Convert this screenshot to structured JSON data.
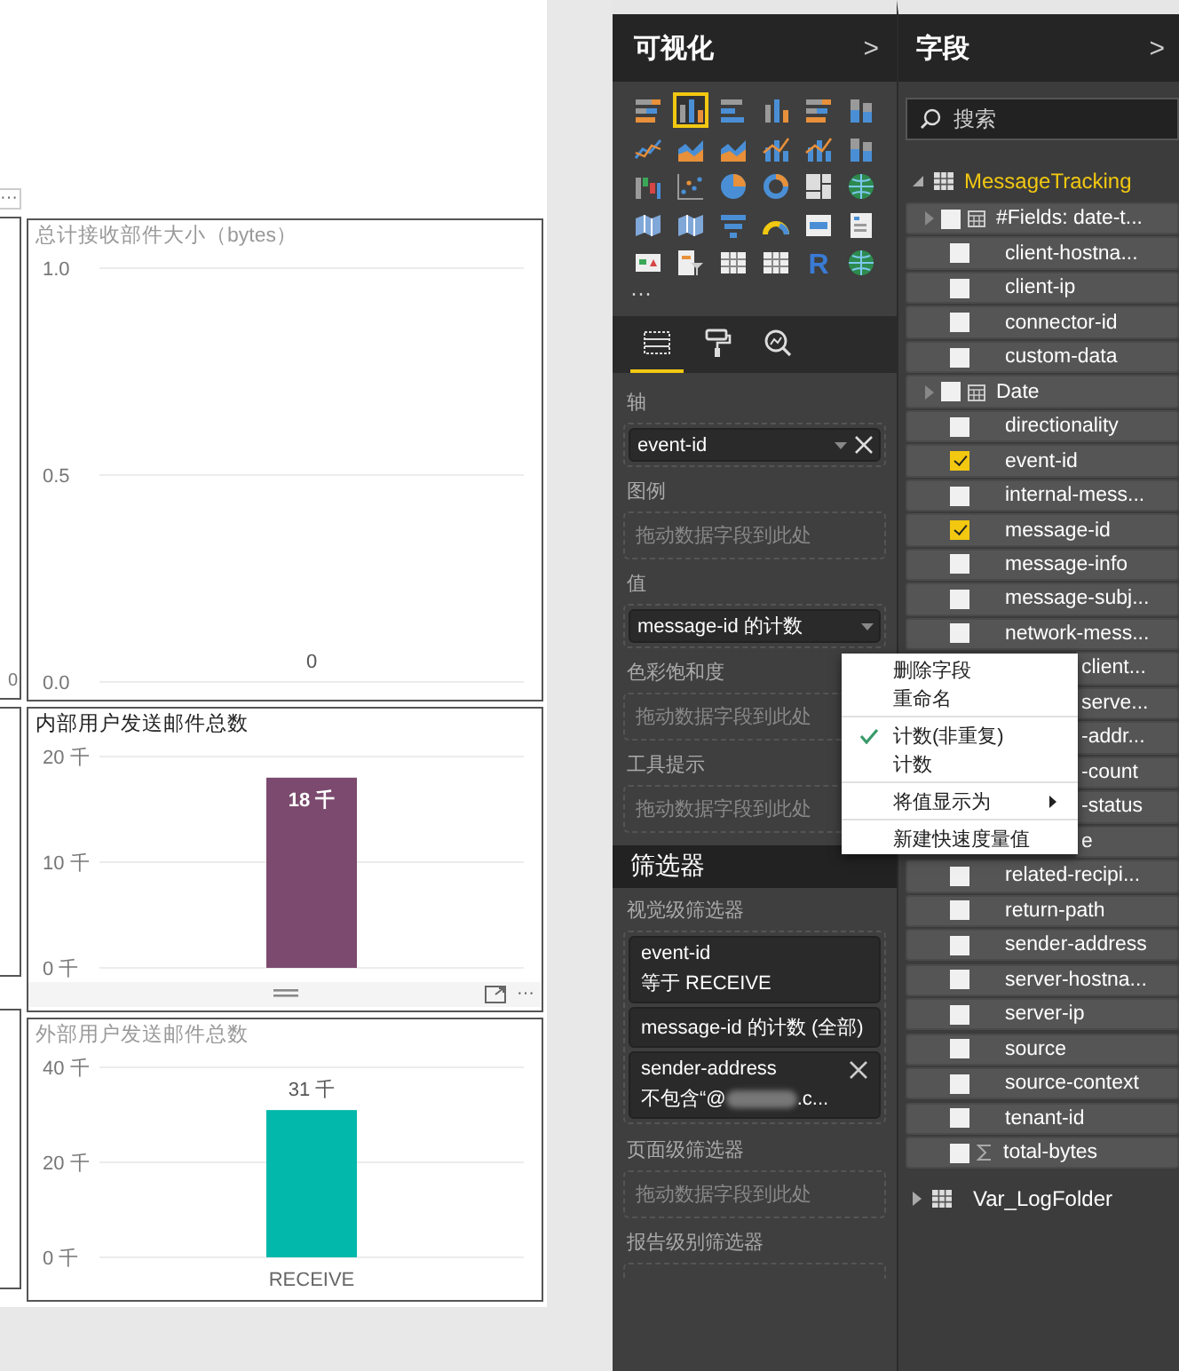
{
  "canvas": {
    "left_visual": {
      "more": "···",
      "tick": "0"
    },
    "visuals": [
      {
        "focused": false,
        "chart_data": {
          "type": "bar",
          "title": "总计接收部件大小（bytes）",
          "values": [
            0
          ],
          "ylim": [
            0,
            1
          ],
          "yticks": [
            {
              "value": 0,
              "label": "0.0"
            },
            {
              "value": 0.5,
              "label": "0.5"
            },
            {
              "value": 1,
              "label": "1.0"
            }
          ],
          "value_labels": [
            "0"
          ]
        }
      },
      {
        "focused": true,
        "more": "···",
        "chart_data": {
          "type": "bar",
          "title": "内部用户发送邮件总数",
          "series": [
            {
              "color": "#7b4a6e",
              "values": [
                18
              ]
            }
          ],
          "ylim": [
            0,
            20
          ],
          "yticks": [
            {
              "value": 0,
              "label": "0 千"
            },
            {
              "value": 10,
              "label": "10 千"
            },
            {
              "value": 20,
              "label": "20 千"
            }
          ],
          "value_labels": [
            "18 千"
          ]
        }
      },
      {
        "focused": false,
        "chart_data": {
          "type": "bar",
          "title": "外部用户发送邮件总数",
          "categories": [
            "RECEIVE"
          ],
          "series": [
            {
              "color": "#01b8aa",
              "values": [
                31
              ]
            }
          ],
          "ylim": [
            0,
            40
          ],
          "yticks": [
            {
              "value": 0,
              "label": "0 千"
            },
            {
              "value": 20,
              "label": "20 千"
            },
            {
              "value": 40,
              "label": "40 千"
            }
          ],
          "value_labels": [
            "31 千"
          ]
        }
      }
    ]
  },
  "visualizations": {
    "title": "可视化",
    "collapse": ">",
    "types": [
      {
        "kind": "stacked-bar",
        "selected": false
      },
      {
        "kind": "column",
        "selected": true
      },
      {
        "kind": "bar",
        "selected": false
      },
      {
        "kind": "column",
        "selected": false
      },
      {
        "kind": "stacked-bar",
        "selected": false
      },
      {
        "kind": "stacked-column",
        "selected": false
      },
      {
        "kind": "line",
        "selected": false
      },
      {
        "kind": "area",
        "selected": false
      },
      {
        "kind": "area",
        "selected": false
      },
      {
        "kind": "combo",
        "selected": false
      },
      {
        "kind": "combo",
        "selected": false
      },
      {
        "kind": "stacked-column",
        "selected": false
      },
      {
        "kind": "waterfall",
        "selected": false
      },
      {
        "kind": "scatter",
        "selected": false
      },
      {
        "kind": "pie",
        "selected": false
      },
      {
        "kind": "donut",
        "selected": false
      },
      {
        "kind": "treemap",
        "selected": false
      },
      {
        "kind": "globe",
        "selected": false
      },
      {
        "kind": "map",
        "selected": false
      },
      {
        "kind": "map",
        "selected": false
      },
      {
        "kind": "funnel",
        "selected": false
      },
      {
        "kind": "gauge",
        "selected": false
      },
      {
        "kind": "card",
        "selected": false
      },
      {
        "kind": "list",
        "selected": false
      },
      {
        "kind": "kpi",
        "selected": false
      },
      {
        "kind": "slicer",
        "selected": false
      },
      {
        "kind": "table",
        "selected": false
      },
      {
        "kind": "table",
        "selected": false
      },
      {
        "kind": "letter",
        "glyph": "R",
        "selected": false
      },
      {
        "kind": "globe",
        "selected": false
      }
    ],
    "more": "···",
    "tabs": [
      {
        "kind": "fields",
        "selected": true
      },
      {
        "kind": "format",
        "selected": false
      },
      {
        "kind": "analytics",
        "selected": false
      }
    ],
    "wells": [
      {
        "label": "轴",
        "value": "event-id",
        "removable": true
      },
      {
        "label": "图例",
        "placeholder": "拖动数据字段到此处"
      },
      {
        "label": "值",
        "value": "message-id 的计数",
        "removable": false
      },
      {
        "label": "色彩饱和度",
        "placeholder": "拖动数据字段到此处"
      },
      {
        "label": "工具提示",
        "placeholder": "拖动数据字段到此处"
      }
    ],
    "filters": {
      "title": "筛选器",
      "sections": [
        {
          "label": "视觉级筛选器",
          "cards": [
            {
              "field": "event-id",
              "condition": "等于 RECEIVE",
              "removable": false
            },
            {
              "field": "message-id 的计数 (全部)",
              "removable": false
            },
            {
              "field": "sender-address",
              "condition": "不包含“@",
              "condition_end": ".c...",
              "removable": true,
              "redacted": true
            }
          ]
        },
        {
          "label": "页面级筛选器",
          "placeholder": "拖动数据字段到此处"
        },
        {
          "label": "报告级别筛选器"
        }
      ]
    }
  },
  "fields": {
    "title": "字段",
    "collapse": ">",
    "search": {
      "placeholder": "搜索"
    },
    "tables": [
      {
        "name": "MessageTracking",
        "expanded": true,
        "children": [
          {
            "name": "#Fields: date-t...",
            "kind": "date",
            "checked": false
          },
          {
            "name": "client-hostna...",
            "kind": "field",
            "checked": false
          },
          {
            "name": "client-ip",
            "kind": "field",
            "checked": false
          },
          {
            "name": "connector-id",
            "kind": "field",
            "checked": false
          },
          {
            "name": "custom-data",
            "kind": "field",
            "checked": false
          },
          {
            "name": "Date",
            "kind": "date",
            "checked": false
          },
          {
            "name": "directionality",
            "kind": "field",
            "checked": false
          },
          {
            "name": "event-id",
            "kind": "field",
            "checked": true
          },
          {
            "name": "internal-mess...",
            "kind": "field",
            "checked": false
          },
          {
            "name": "message-id",
            "kind": "field",
            "checked": true
          },
          {
            "name": "message-info",
            "kind": "field",
            "checked": false
          },
          {
            "name": "message-subj...",
            "kind": "field",
            "checked": false
          },
          {
            "name": "network-mess...",
            "kind": "field",
            "checked": false
          },
          {
            "name": "client...",
            "kind": "covered"
          },
          {
            "name": "serve...",
            "kind": "covered"
          },
          {
            "name": "-addr...",
            "kind": "covered"
          },
          {
            "name": "-count",
            "kind": "covered"
          },
          {
            "name": "-status",
            "kind": "covered"
          },
          {
            "name": "e",
            "kind": "covered"
          },
          {
            "name": "related-recipi...",
            "kind": "field",
            "checked": false
          },
          {
            "name": "return-path",
            "kind": "field",
            "checked": false
          },
          {
            "name": "sender-address",
            "kind": "field",
            "checked": false
          },
          {
            "name": "server-hostna...",
            "kind": "field",
            "checked": false
          },
          {
            "name": "server-ip",
            "kind": "field",
            "checked": false
          },
          {
            "name": "source",
            "kind": "field",
            "checked": false
          },
          {
            "name": "source-context",
            "kind": "field",
            "checked": false
          },
          {
            "name": "tenant-id",
            "kind": "field",
            "checked": false
          },
          {
            "name": "total-bytes",
            "kind": "measure",
            "checked": false
          }
        ]
      },
      {
        "name": "Var_LogFolder",
        "expanded": false
      }
    ]
  },
  "context_menu": {
    "items": [
      {
        "kind": "item",
        "label": "删除字段",
        "checked": false,
        "submenu": false
      },
      {
        "kind": "item",
        "label": "重命名",
        "checked": false,
        "submenu": false
      },
      {
        "kind": "separator"
      },
      {
        "kind": "item",
        "label": "计数(非重复)",
        "checked": true,
        "submenu": false
      },
      {
        "kind": "item",
        "label": "计数",
        "checked": false,
        "submenu": false
      },
      {
        "kind": "separator"
      },
      {
        "kind": "item",
        "label": "将值显示为",
        "checked": false,
        "submenu": true
      },
      {
        "kind": "separator"
      },
      {
        "kind": "item",
        "label": "新建快速度量值",
        "checked": false,
        "submenu": false
      }
    ]
  }
}
